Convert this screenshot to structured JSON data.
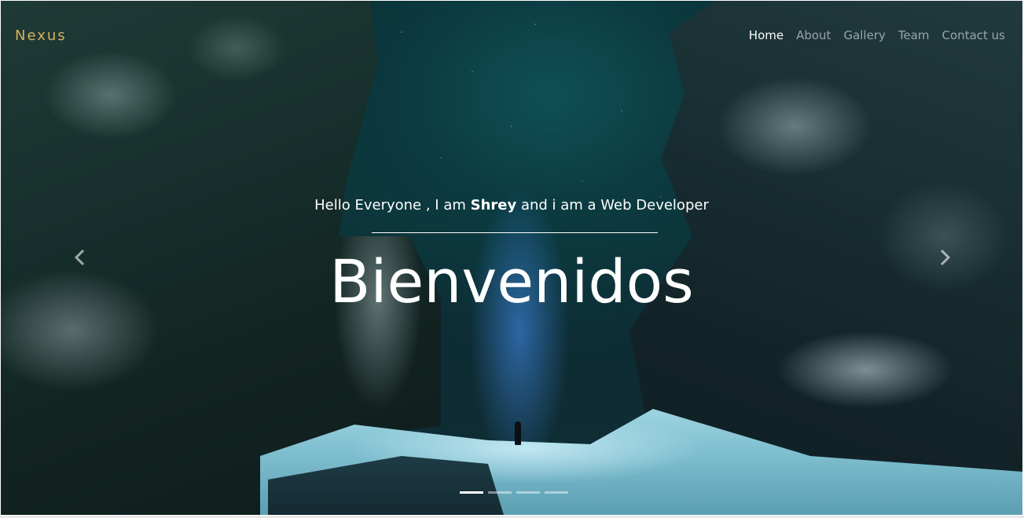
{
  "brand": {
    "name": "Nexus",
    "color": "#d8b25a"
  },
  "nav": {
    "items": [
      {
        "label": "Home",
        "active": true
      },
      {
        "label": "About",
        "active": false
      },
      {
        "label": "Gallery",
        "active": false
      },
      {
        "label": "Team",
        "active": false
      },
      {
        "label": "Contact us",
        "active": false
      }
    ]
  },
  "hero": {
    "subtitle_prefix": "Hello Everyone , I am ",
    "subtitle_name": "Shrey",
    "subtitle_suffix": " and i am a Web Developer",
    "title": "Bienvenidos"
  },
  "carousel": {
    "prev_icon": "chevron-left-icon",
    "next_icon": "chevron-right-icon",
    "slide_count": 4,
    "active_slide": 1
  }
}
